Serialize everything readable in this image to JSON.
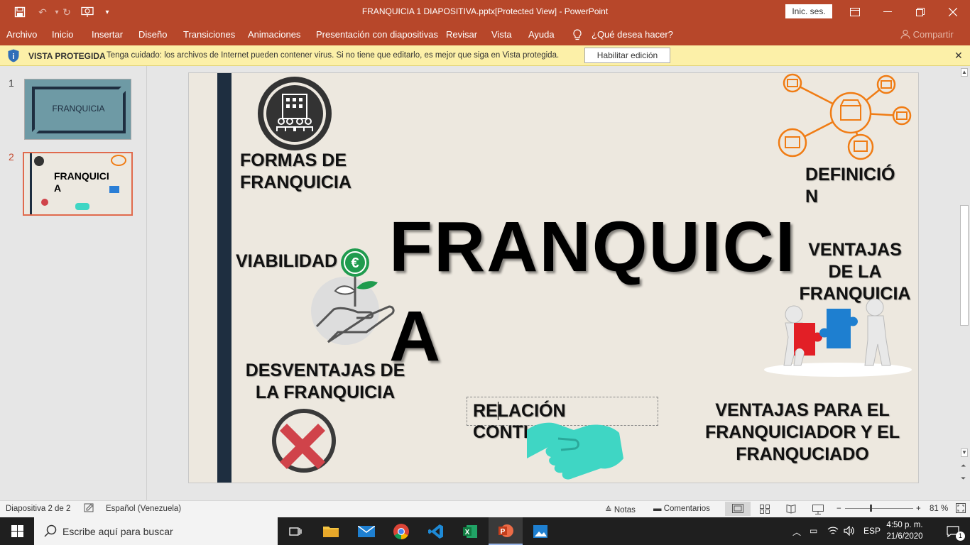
{
  "titlebar": {
    "doc_title": "FRANQUICIA 1 DIAPOSITIVA.pptx[Protected View]  -  PowerPoint",
    "signin_label": "Inic. ses."
  },
  "menu": {
    "items": [
      "Archivo",
      "Inicio",
      "Insertar",
      "Diseño",
      "Transiciones",
      "Animaciones",
      "Presentación con diapositivas",
      "Revisar",
      "Vista",
      "Ayuda"
    ],
    "tell_me": "¿Qué desea hacer?",
    "share": "Compartir"
  },
  "protected_bar": {
    "title": "VISTA PROTEGIDA",
    "message": "Tenga cuidado: los archivos de Internet pueden contener virus. Si no tiene que editarlo, es mejor que siga en Vista protegida.",
    "enable_button": "Habilitar edición"
  },
  "thumbnails": {
    "numbers": [
      "1",
      "2"
    ],
    "slide1_title": "FRANQUICIA",
    "slide2_title": "FRANQUICI A",
    "active": 2
  },
  "slide": {
    "title": "FRANQUICIA",
    "formas": "FORMAS DE FRANQUICIA",
    "definicion": "DEFINICIÓ N",
    "viabilidad": "VIABILIDAD",
    "ventajas": "VENTAJAS DE LA FRANQUICIA",
    "desventajas": "DESVENTAJAS DE LA FRANQUICIA",
    "relacion": "RELACIÓN CONTI",
    "ventajas_para": "VENTAJAS PARA EL FRANQUICIADOR Y EL FRANQUCIADO"
  },
  "status": {
    "slide_info": "Diapositiva 2 de 2",
    "language": "Español (Venezuela)",
    "notes": "Notas",
    "comments": "Comentarios",
    "zoom": "81 %"
  },
  "taskbar": {
    "search_placeholder": "Escribe aquí para buscar",
    "lang": "ESP",
    "time": "4:50 p. m.",
    "date": "21/6/2020",
    "notif_count": "1"
  },
  "colors": {
    "ppt_accent": "#b7472a",
    "protected_bar": "#fcf0a8",
    "slide_bar": "#1e2e40",
    "orange_icon": "#f07c14",
    "teal_hands": "#3fd6c4",
    "red_x": "#d0434a"
  }
}
